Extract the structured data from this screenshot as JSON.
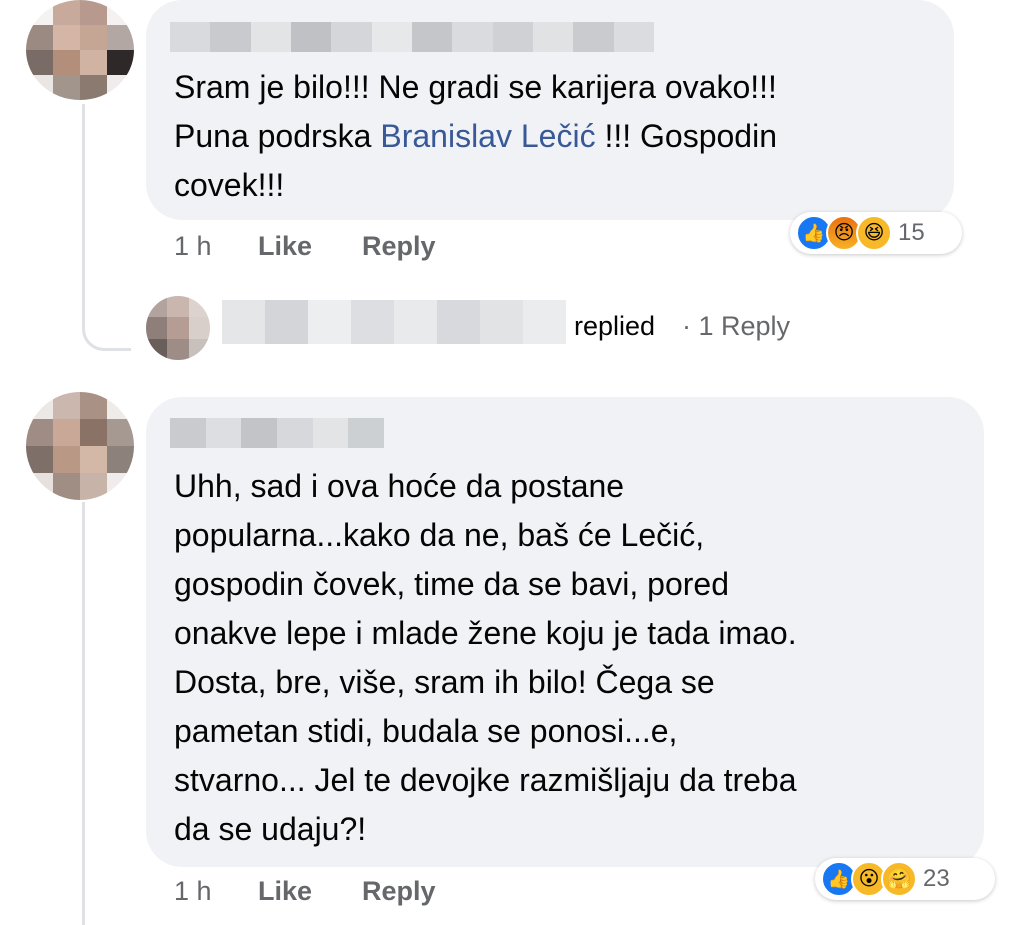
{
  "comments": [
    {
      "text_before_mention": "Sram je bilo!!! Ne gradi se karijera ovako!!!\nPuna podrska ",
      "mention": "Branislav Lečić",
      "text_after_mention": " !!! Gospodin\ncovek!!!",
      "time": "1 h",
      "like_label": "Like",
      "reply_label": "Reply",
      "reaction_count": "15",
      "reactions": [
        "like-icon",
        "angry-icon",
        "haha-icon"
      ]
    },
    {
      "text": "Uhh, sad i ova hoće da postane\npopularna...kako da ne, baš  će Lečić,\ngospodin čovek, time da se bavi, pored\nonakve lepe i mlade žene koju je tada imao.\nDosta, bre, više, sram ih bilo! Čega se\npametan stidi, budala se ponosi...e,\nstvarno... Jel te devojke razmišljaju da treba\nda se udaju?!",
      "time": "1 h",
      "like_label": "Like",
      "reply_label": "Reply",
      "reaction_count": "23",
      "reactions": [
        "like-icon",
        "wow-icon",
        "care-icon"
      ]
    }
  ],
  "reply_summary": {
    "replied_label": "replied",
    "reply_count_label": "· 1 Reply"
  },
  "colors": {
    "bubble": "#f0f2f5",
    "mention": "#385898",
    "meta": "#65676b",
    "like_blue": "#1877f2"
  }
}
